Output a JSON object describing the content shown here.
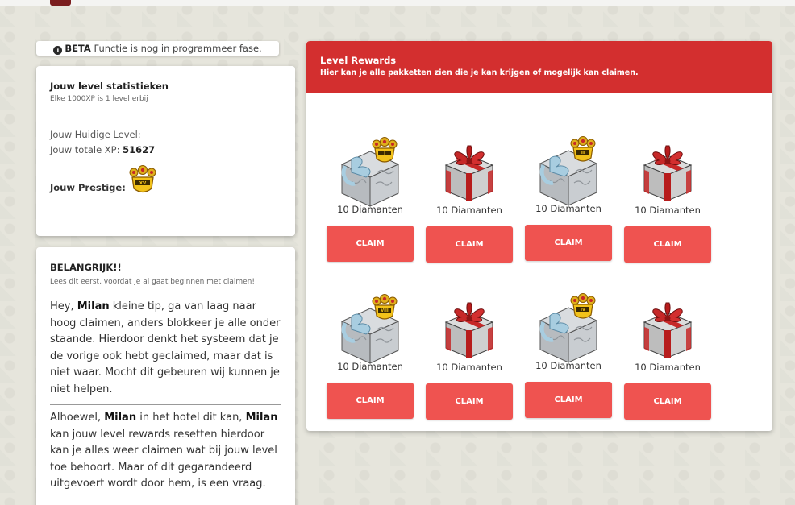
{
  "beta_notice": {
    "tag": "BETA",
    "text": " Functie is nog in programmeer fase."
  },
  "stats": {
    "title": "Jouw level statistieken",
    "subtitle": "Elke 1000XP is 1 level erbij",
    "level_label": "Jouw Huidige Level:",
    "level_value": "",
    "xp_label": "Jouw totale XP:",
    "xp_value": "51627",
    "prestige_label": "Jouw Prestige:",
    "prestige_badge": "XV"
  },
  "important": {
    "title": "BELANGRIJK!!",
    "subtitle": "Lees dit eerst, voordat je al gaat beginnen met claimen!",
    "p1_a": "Hey, ",
    "p1_name": "Milan",
    "p1_b": " kleine tip, ga van laag naar hoog claimen, anders blokkeer je alle onder staande. Hierdoor denkt het systeem dat je de vorige ook hebt geclaimed, maar dat is niet waar. Mocht dit gebeuren wij kunnen je niet helpen.",
    "p2_a": "Alhoewel, ",
    "p2_name1": "Milan",
    "p2_b": " in het hotel dit kan, ",
    "p2_name2": "Milan",
    "p2_c": " kan jouw level rewards resetten hierdoor kan je alles weer claimen wat bij jouw level toe behoort. Maar of dit gegarandeerd uitgevoert wordt door hem, is een vraag."
  },
  "rewards": {
    "title": "Level Rewards",
    "subtitle": "Hier kan je alle pakketten zien die je kan krijgen of mogelijk kan claimen.",
    "items": [
      {
        "amount": "10 Diamanten",
        "claim": "CLAIM",
        "kind": "silver-gift",
        "badge": "I"
      },
      {
        "amount": "10 Diamanten",
        "claim": "CLAIM",
        "kind": "red-gift",
        "badge": ""
      },
      {
        "amount": "10 Diamanten",
        "claim": "CLAIM",
        "kind": "silver-gift",
        "badge": "III"
      },
      {
        "amount": "10 Diamanten",
        "claim": "CLAIM",
        "kind": "red-gift",
        "badge": ""
      },
      {
        "amount": "10 Diamanten",
        "claim": "CLAIM",
        "kind": "silver-gift",
        "badge": "VIII"
      },
      {
        "amount": "10 Diamanten",
        "claim": "CLAIM",
        "kind": "red-gift",
        "badge": ""
      },
      {
        "amount": "10 Diamanten",
        "claim": "CLAIM",
        "kind": "silver-gift",
        "badge": "IV"
      },
      {
        "amount": "10 Diamanten",
        "claim": "CLAIM",
        "kind": "red-gift",
        "badge": ""
      }
    ]
  }
}
